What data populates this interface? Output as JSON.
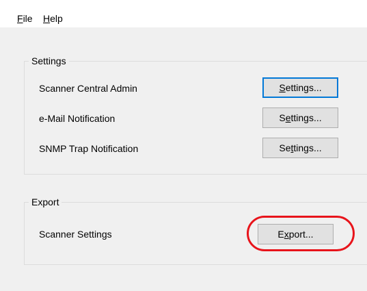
{
  "menu": {
    "file": {
      "mnemonic": "F",
      "rest": "ile"
    },
    "help": {
      "mnemonic": "H",
      "rest": "elp"
    }
  },
  "settings_group": {
    "title": "Settings",
    "rows": [
      {
        "label": "Scanner Central Admin",
        "button": {
          "pre": "",
          "mnemonic": "S",
          "post": "ettings..."
        }
      },
      {
        "label": "e-Mail Notification",
        "button": {
          "pre": "S",
          "mnemonic": "e",
          "post": "ttings..."
        }
      },
      {
        "label": "SNMP Trap Notification",
        "button": {
          "pre": "Se",
          "mnemonic": "t",
          "post": "tings..."
        }
      }
    ]
  },
  "export_group": {
    "title": "Export",
    "row": {
      "label": "Scanner Settings",
      "button": {
        "pre": "E",
        "mnemonic": "x",
        "post": "port..."
      }
    }
  },
  "colors": {
    "window_bg": "#f0f0f0",
    "menubar_bg": "#ffffff",
    "button_bg": "#e1e1e1",
    "focus_border": "#0078d7",
    "highlight_ring": "#e8141b"
  }
}
